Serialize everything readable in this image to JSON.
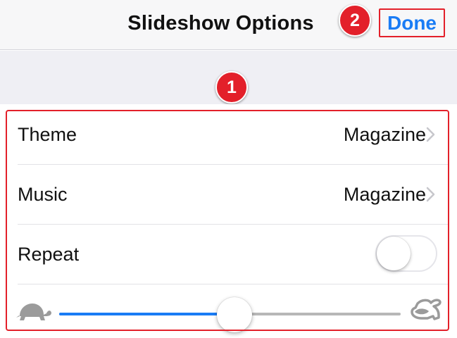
{
  "header": {
    "title": "Slideshow Options",
    "done_label": "Done"
  },
  "callouts": {
    "one": "1",
    "two": "2"
  },
  "options": {
    "theme": {
      "label": "Theme",
      "value": "Magazine"
    },
    "music": {
      "label": "Music",
      "value": "Magazine"
    },
    "repeat": {
      "label": "Repeat",
      "enabled": false
    }
  },
  "speed_slider": {
    "value_fraction": 0.5,
    "min_icon": "turtle-icon",
    "max_icon": "hare-icon"
  },
  "colors": {
    "accent": "#1a7cf5",
    "callout_red": "#e3202a",
    "nav_background": "#f7f7f8",
    "group_background": "#efeff4"
  }
}
